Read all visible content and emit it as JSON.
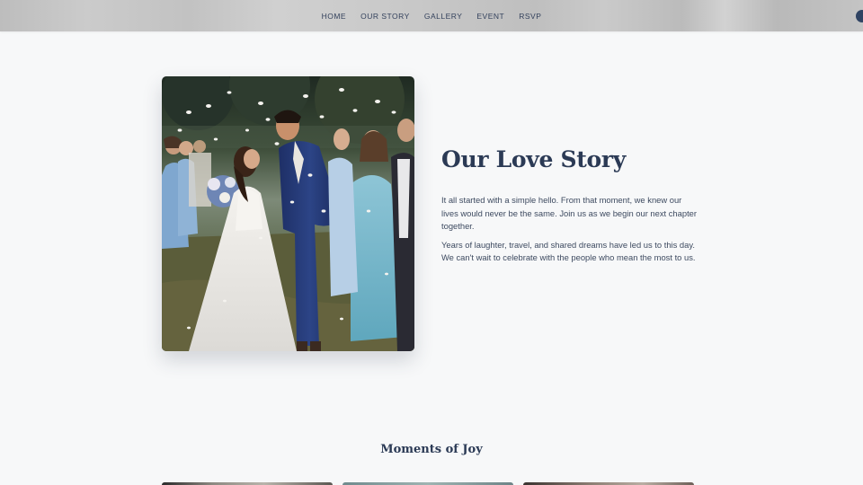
{
  "nav": {
    "items": [
      {
        "label": "HOME"
      },
      {
        "label": "OUR STORY"
      },
      {
        "label": "GALLERY"
      },
      {
        "label": "EVENT"
      },
      {
        "label": "RSVP"
      }
    ]
  },
  "story": {
    "title": "Our Love Story",
    "paragraphs": [
      "It all started with a simple hello. From that moment, we knew our lives would never be the same. Join us as we begin our next chapter together.",
      "Years of laughter, travel, and shared dreams have led us to this day. We can't wait to celebrate with the people who mean the most to us."
    ],
    "photo_icon": "wedding-couple-photo"
  },
  "moments": {
    "title": "Moments of Joy"
  },
  "colors": {
    "primary_text": "#2b3a55",
    "body_text": "#3d4a60",
    "background": "#f7f8f9",
    "nav_bg": "#c4c4c4",
    "accent": "#2f4363"
  }
}
